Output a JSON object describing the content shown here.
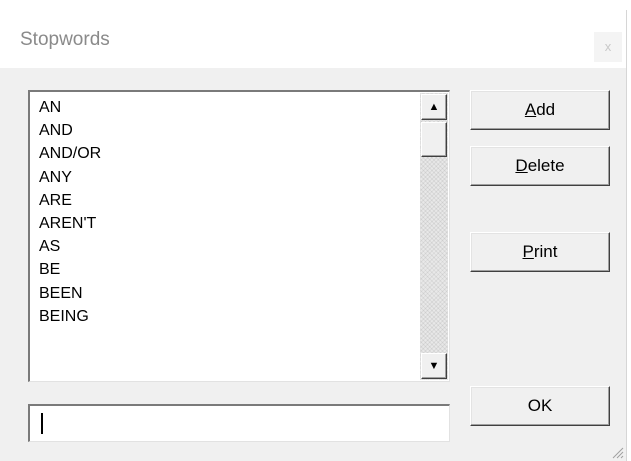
{
  "window": {
    "title": "Stopwords",
    "close_label": "x"
  },
  "stopword_list": {
    "items": [
      "AN",
      "AND",
      "AND/OR",
      "ANY",
      "ARE",
      "AREN'T",
      "AS",
      "BE",
      "BEEN",
      "BEING"
    ]
  },
  "scrollbar": {
    "up_glyph": "▲",
    "down_glyph": "▼"
  },
  "buttons": {
    "add": {
      "mnemonic": "A",
      "rest": "dd"
    },
    "delete": {
      "mnemonic": "D",
      "rest": "elete"
    },
    "print": {
      "mnemonic": "P",
      "rest": "rint"
    },
    "ok": {
      "label": "OK"
    }
  },
  "new_word_input": {
    "value": ""
  },
  "icons": {
    "close": "close-icon",
    "scroll_up": "arrow-up-icon",
    "scroll_down": "arrow-down-icon",
    "resize_grip": "resize-grip-icon"
  }
}
